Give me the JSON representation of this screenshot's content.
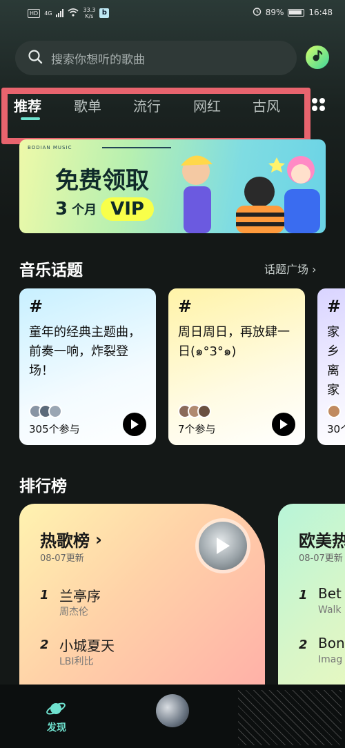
{
  "status": {
    "hd": "HD",
    "net": "4G",
    "speed": "33.3\nK/s",
    "app_badge": "b",
    "battery": "89%",
    "time": "16:48"
  },
  "search": {
    "placeholder": "搜索你想听的歌曲"
  },
  "tabs": [
    "推荐",
    "歌单",
    "流行",
    "网红",
    "古风"
  ],
  "banner": {
    "brand": "BODIAN MUSIC",
    "headline": "免费领取",
    "months_num": "3",
    "months_unit": "个月",
    "vip": "VIP"
  },
  "topics": {
    "title": "音乐话题",
    "link": "话题广场",
    "cards": [
      {
        "hash": "#",
        "text": "童年的经典主题曲，前奏一响，炸裂登场！",
        "count": "305个参与"
      },
      {
        "hash": "#",
        "text": "周日周日，再放肆一日(๑°3°๑)",
        "count": "7个参与"
      },
      {
        "hash": "#",
        "text": "家乡离家",
        "count": "30个"
      }
    ]
  },
  "charts": {
    "title": "排行榜",
    "cards": [
      {
        "name": "热歌榜",
        "updated": "08-07更新",
        "rows": [
          {
            "no": "1",
            "song": "兰亭序",
            "artist": "周杰伦"
          },
          {
            "no": "2",
            "song": "小城夏天",
            "artist": "LBI利比"
          }
        ]
      },
      {
        "name": "欧美热",
        "updated": "08-07更新",
        "rows": [
          {
            "no": "1",
            "song": "Bet",
            "artist": "Walk"
          },
          {
            "no": "2",
            "song": "Bon",
            "artist": "Imag"
          }
        ]
      }
    ]
  },
  "nav": {
    "discover": "发现"
  },
  "colors": {
    "accent": "#6fe2cf",
    "highlight": "#e8646e",
    "background": "#141817"
  }
}
